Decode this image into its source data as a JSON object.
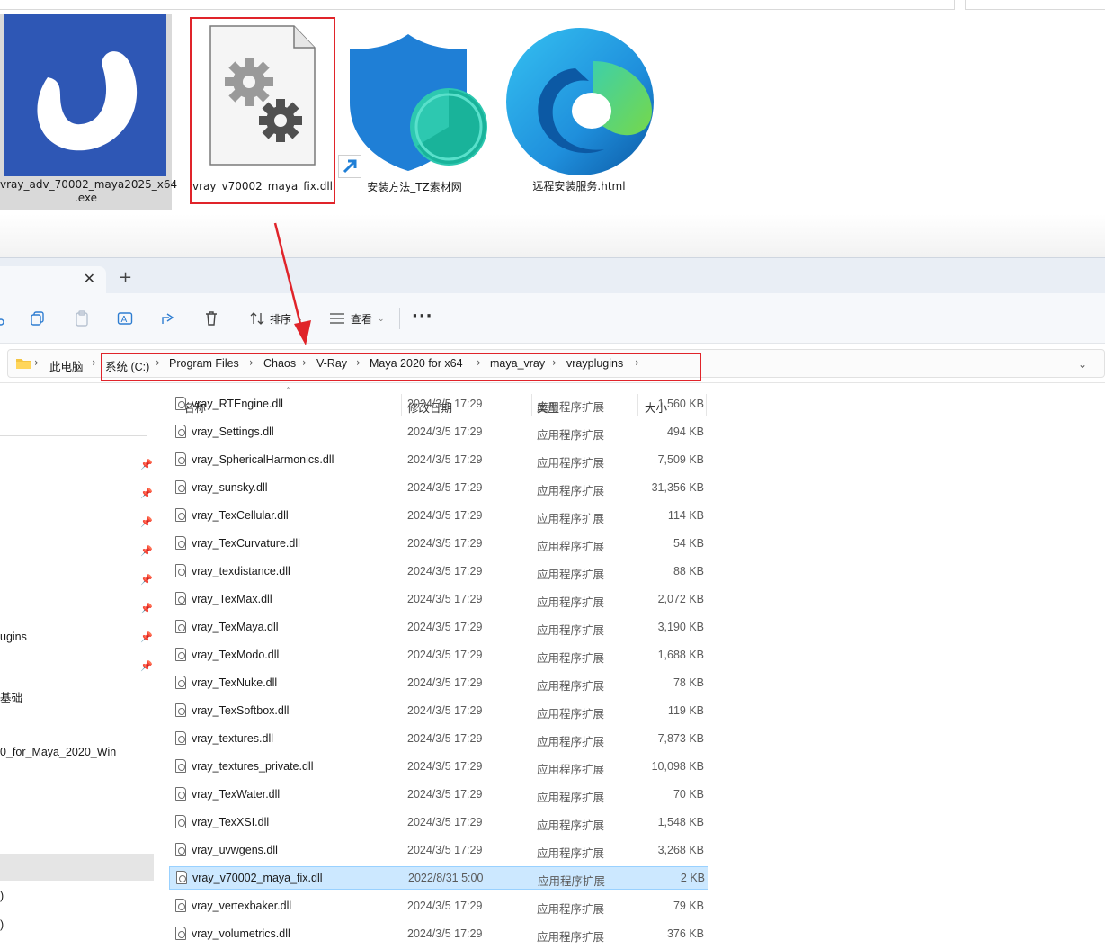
{
  "desktop": {
    "icons": [
      {
        "label": "vray_adv_70002_maya2025_x64\n.exe"
      },
      {
        "label": "vray_v70002_maya_fix.dll"
      },
      {
        "label": "安装方法_TZ素材网"
      },
      {
        "label": "远程安装服务.html"
      }
    ]
  },
  "toolbar": {
    "sort_label": "排序",
    "view_label": "查看"
  },
  "address": {
    "root": "此电脑",
    "crumbs": [
      "系统 (C:)",
      "Program Files",
      "Chaos",
      "V-Ray",
      "Maya 2020 for x64",
      "maya_vray",
      "vrayplugins"
    ]
  },
  "nav": {
    "items": [
      "ugins",
      "基础",
      "0_for_Maya_2020_Win",
      ")",
      ")"
    ]
  },
  "columns": {
    "name": "名称",
    "date": "修改日期",
    "type": "类型",
    "size": "大小"
  },
  "files": [
    {
      "name": "vray_RTEngine.dll",
      "date": "2024/3/5 17:29",
      "type": "应用程序扩展",
      "size": "1,560 KB"
    },
    {
      "name": "vray_Settings.dll",
      "date": "2024/3/5 17:29",
      "type": "应用程序扩展",
      "size": "494 KB"
    },
    {
      "name": "vray_SphericalHarmonics.dll",
      "date": "2024/3/5 17:29",
      "type": "应用程序扩展",
      "size": "7,509 KB"
    },
    {
      "name": "vray_sunsky.dll",
      "date": "2024/3/5 17:29",
      "type": "应用程序扩展",
      "size": "31,356 KB"
    },
    {
      "name": "vray_TexCellular.dll",
      "date": "2024/3/5 17:29",
      "type": "应用程序扩展",
      "size": "114 KB"
    },
    {
      "name": "vray_TexCurvature.dll",
      "date": "2024/3/5 17:29",
      "type": "应用程序扩展",
      "size": "54 KB"
    },
    {
      "name": "vray_texdistance.dll",
      "date": "2024/3/5 17:29",
      "type": "应用程序扩展",
      "size": "88 KB"
    },
    {
      "name": "vray_TexMax.dll",
      "date": "2024/3/5 17:29",
      "type": "应用程序扩展",
      "size": "2,072 KB"
    },
    {
      "name": "vray_TexMaya.dll",
      "date": "2024/3/5 17:29",
      "type": "应用程序扩展",
      "size": "3,190 KB"
    },
    {
      "name": "vray_TexModo.dll",
      "date": "2024/3/5 17:29",
      "type": "应用程序扩展",
      "size": "1,688 KB"
    },
    {
      "name": "vray_TexNuke.dll",
      "date": "2024/3/5 17:29",
      "type": "应用程序扩展",
      "size": "78 KB"
    },
    {
      "name": "vray_TexSoftbox.dll",
      "date": "2024/3/5 17:29",
      "type": "应用程序扩展",
      "size": "119 KB"
    },
    {
      "name": "vray_textures.dll",
      "date": "2024/3/5 17:29",
      "type": "应用程序扩展",
      "size": "7,873 KB"
    },
    {
      "name": "vray_textures_private.dll",
      "date": "2024/3/5 17:29",
      "type": "应用程序扩展",
      "size": "10,098 KB"
    },
    {
      "name": "vray_TexWater.dll",
      "date": "2024/3/5 17:29",
      "type": "应用程序扩展",
      "size": "70 KB"
    },
    {
      "name": "vray_TexXSI.dll",
      "date": "2024/3/5 17:29",
      "type": "应用程序扩展",
      "size": "1,548 KB"
    },
    {
      "name": "vray_uvwgens.dll",
      "date": "2024/3/5 17:29",
      "type": "应用程序扩展",
      "size": "3,268 KB"
    },
    {
      "name": "vray_v70002_maya_fix.dll",
      "date": "2022/8/31 5:00",
      "type": "应用程序扩展",
      "size": "2 KB",
      "selected": true
    },
    {
      "name": "vray_vertexbaker.dll",
      "date": "2024/3/5 17:29",
      "type": "应用程序扩展",
      "size": "79 KB"
    },
    {
      "name": "vray_volumetrics.dll",
      "date": "2024/3/5 17:29",
      "type": "应用程序扩展",
      "size": "376 KB"
    }
  ],
  "colors": {
    "annotation_red": "#e0242a",
    "selection_bg": "#cce8ff",
    "vray_blue": "#2e57b5"
  }
}
